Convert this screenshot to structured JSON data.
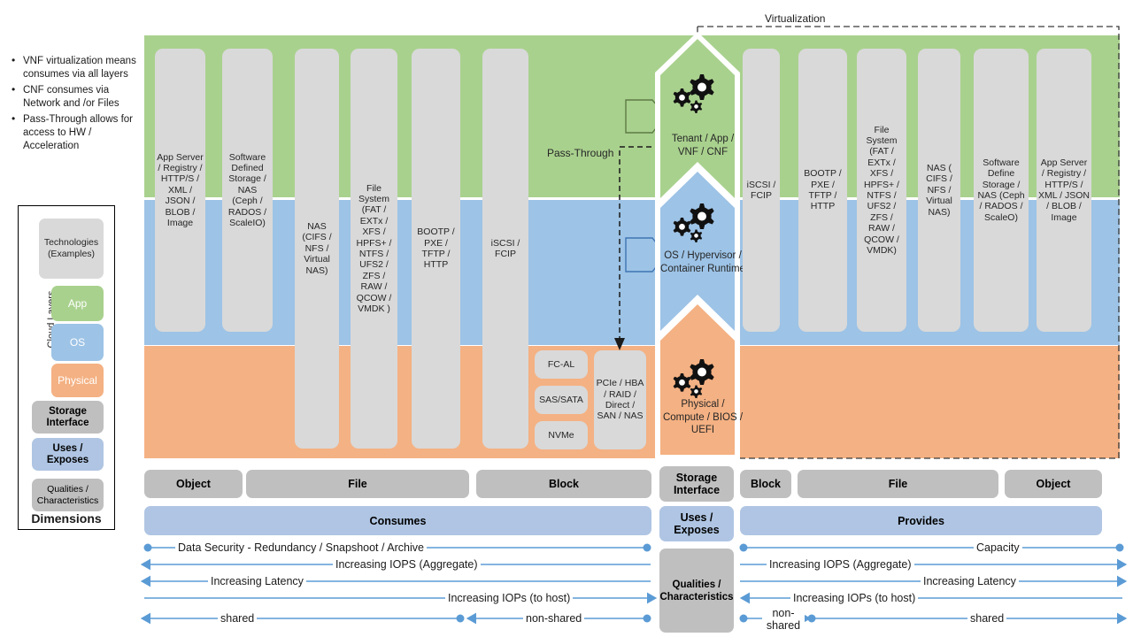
{
  "notes": {
    "bullets": [
      "VNF virtualization means consumes via all layers",
      "CNF consumes via Network and /or Files",
      "Pass-Through allows for access to HW / Acceleration"
    ]
  },
  "legend": {
    "technologies": "Technologies (Examples)",
    "cloud_layers_label": "Cloud Layers",
    "layers": [
      {
        "label": "App",
        "color": "#A9D18E"
      },
      {
        "label": "OS",
        "color": "#9DC3E6"
      },
      {
        "label": "Physical",
        "color": "#F4B183"
      }
    ],
    "storage_interface": "Storage Interface",
    "uses_exposes": "Uses / Exposes",
    "qualities": "Qualities / Characteristics",
    "dimensions_title": "Dimensions"
  },
  "diagram": {
    "virtualization_label": "Virtualization",
    "pass_through_label": "Pass-Through",
    "bands": [
      {
        "name": "app",
        "color": "#A9D18E"
      },
      {
        "name": "os",
        "color": "#9DC3E6"
      },
      {
        "name": "physical",
        "color": "#F4B183"
      }
    ],
    "left_columns": [
      {
        "id": "app-server-left",
        "text": "App Server / Registry / HTTP/S / XML / JSON / BLOB / Image"
      },
      {
        "id": "sds-left",
        "text": "Software Defined Storage / NAS (Ceph / RADOS / ScaleIO)"
      },
      {
        "id": "nas-left",
        "text": "NAS (CIFS / NFS / Virtual NAS)"
      },
      {
        "id": "filesystem-left",
        "text": "File System (FAT / EXTx / XFS / HPFS+ / NTFS / UFS2 / ZFS / RAW / QCOW / VMDK )"
      },
      {
        "id": "bootp-left",
        "text": "BOOTP / PXE / TFTP / HTTP"
      },
      {
        "id": "iscsi-left",
        "text": "iSCSI / FCIP"
      }
    ],
    "physical_small": [
      {
        "id": "fc-al",
        "text": "FC-AL"
      },
      {
        "id": "sas-sata",
        "text": "SAS/SATA"
      },
      {
        "id": "nvme",
        "text": "NVMe"
      }
    ],
    "physical_wide": {
      "id": "pcie-hba",
      "text": "PCIe / HBA / RAID / Direct / SAN / NAS"
    },
    "center_stack": [
      {
        "id": "tenant-app",
        "text": "Tenant / App / VNF / CNF",
        "color": "#A9D18E"
      },
      {
        "id": "os-hyp",
        "text": "OS / Hypervisor / Container Runtime",
        "color": "#9DC3E6"
      },
      {
        "id": "physical",
        "text": "Physical / Compute / BIOS / UEFI",
        "color": "#F4B183"
      }
    ],
    "right_columns": [
      {
        "id": "iscsi-right",
        "text": "iSCSI / FCIP"
      },
      {
        "id": "bootp-right",
        "text": "BOOTP / PXE / TFTP / HTTP"
      },
      {
        "id": "filesystem-right",
        "text": "File System (FAT / EXTx / XFS / HPFS+ / NTFS / UFS2 / ZFS /  RAW / QCOW / VMDK)"
      },
      {
        "id": "nas-right",
        "text": "NAS ( CIFS / NFS / Virtual NAS)"
      },
      {
        "id": "sds-right",
        "text": "Software Define Storage / NAS (Ceph / RADOS / ScaleO)"
      },
      {
        "id": "app-server-right",
        "text": "App Server / Registry / HTTP/S / XML / JSON / BLOB / Image"
      }
    ],
    "interface_row_left": [
      "Object",
      "File",
      "Block"
    ],
    "interface_center": "Storage Interface",
    "interface_row_right": [
      "Block",
      "File",
      "Object"
    ],
    "verb_left": "Consumes",
    "verb_center": "Uses / Exposes",
    "verb_right": "Provides",
    "qualities_center": "Qualities / Characteristics",
    "dimension_arrows_left": [
      {
        "label": "Data Security - Redundancy / Snapshoot / Archive",
        "start": "dot",
        "end": "dot"
      },
      {
        "label": "Increasing IOPS (Aggregate)",
        "start": "arrow",
        "end": "none"
      },
      {
        "label": "Increasing Latency",
        "start": "arrow",
        "end": "none"
      },
      {
        "label": "Increasing IOPs (to host)",
        "start": "none",
        "end": "arrow"
      }
    ],
    "dimension_arrows_right": [
      {
        "label": "Capacity",
        "start": "dot",
        "end": "dot"
      },
      {
        "label": "Increasing IOPS (Aggregate)",
        "start": "none",
        "end": "arrow"
      },
      {
        "label": "Increasing Latency",
        "start": "none",
        "end": "arrow"
      },
      {
        "label": "Increasing IOPs (to host)",
        "start": "arrow",
        "end": "none"
      }
    ],
    "shared_left": "shared",
    "nonshared_left": "non-shared",
    "nonshared_right": "non-shared",
    "shared_right": "shared"
  }
}
